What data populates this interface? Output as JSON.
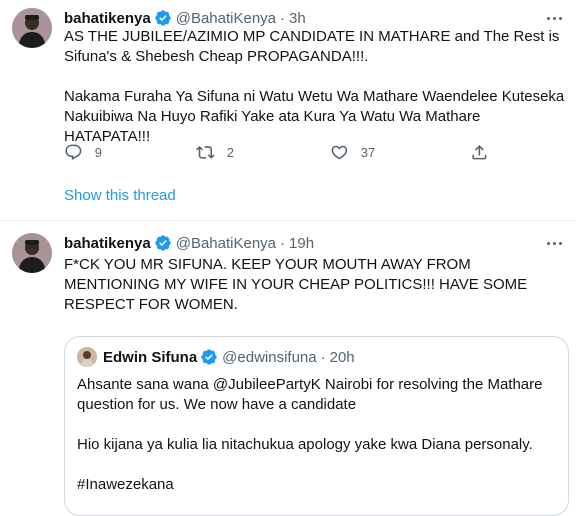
{
  "tweets": [
    {
      "author_name": "bahatikenya",
      "handle": "@BahatiKenya",
      "separator": "·",
      "time": "3h",
      "text": [
        "AS THE JUBILEE/AZIMIO MP CANDIDATE IN MATHARE and The Rest is Sifuna's & Shebesh Cheap PROPAGANDA!!!.",
        "Nakama Furaha Ya Sifuna ni Watu Wetu Wa Mathare Waendelee Kuteseka Nakuibiwa Na Huyo Rafiki Yake ata Kura Ya Watu Wa Mathare HATAPATA!!!"
      ],
      "replies": "9",
      "retweets": "2",
      "likes": "37",
      "show_thread": "Show this thread"
    },
    {
      "author_name": "bahatikenya",
      "handle": "@BahatiKenya",
      "separator": "·",
      "time": "19h",
      "text": "F*CK YOU MR SIFUNA. KEEP YOUR MOUTH AWAY FROM MENTIONING MY WIFE IN YOUR CHEAP POLITICS!!! HAVE SOME RESPECT FOR WOMEN.",
      "quoted": {
        "author_name": "Edwin Sifuna",
        "handle": "@edwinsifuna",
        "separator": "·",
        "time": "20h",
        "lines": [
          "Ahsante sana wana @JubileePartyK Nairobi for resolving the Mathare question for us. We now have a candidate",
          "Hio kijana ya kulia lia nitachukua apology yake kwa Diana personaly.",
          "#Inawezekana"
        ]
      }
    }
  ],
  "colors": {
    "accent": "#1d9bf0",
    "muted": "#536471",
    "text": "#0f1419",
    "border": "#cfd9de"
  },
  "icons": [
    "verified-badge-icon",
    "more-icon",
    "reply-icon",
    "retweet-icon",
    "like-icon",
    "share-icon"
  ]
}
